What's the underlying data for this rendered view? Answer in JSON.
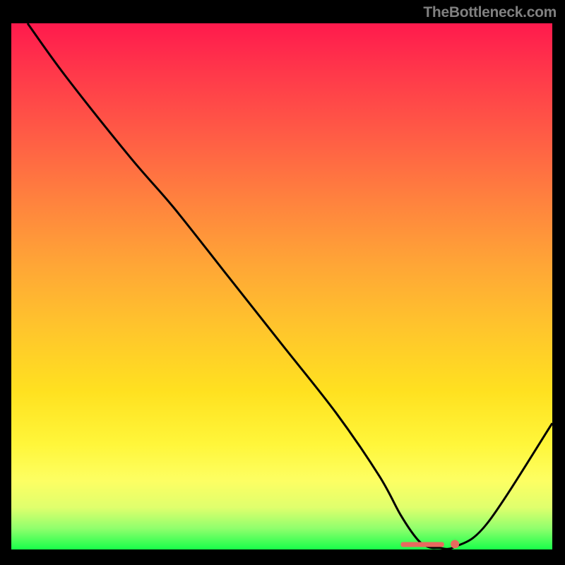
{
  "watermark": "TheBottleneck.com",
  "chart_data": {
    "type": "line",
    "title": "",
    "xlabel": "",
    "ylabel": "",
    "xlim": [
      0,
      100
    ],
    "ylim": [
      0,
      100
    ],
    "x": [
      3,
      10,
      22,
      30,
      40,
      50,
      60,
      68,
      72,
      75,
      77,
      79,
      82,
      88,
      100
    ],
    "y": [
      100,
      90,
      74.5,
      65,
      52,
      39,
      26,
      14,
      6.5,
      2,
      0.5,
      0.3,
      0.5,
      5,
      24
    ],
    "background_gradient": {
      "stops": [
        {
          "pos": 0.0,
          "color": "#ff1a4d"
        },
        {
          "pos": 0.4,
          "color": "#ff9a3a"
        },
        {
          "pos": 0.75,
          "color": "#ffea24"
        },
        {
          "pos": 0.94,
          "color": "#d8ff69"
        },
        {
          "pos": 1.0,
          "color": "#18ff4a"
        }
      ]
    },
    "marker_point": {
      "x": 82,
      "y": 1
    },
    "marker_bar": {
      "x_start": 72,
      "x_end": 80,
      "y": 1
    }
  }
}
